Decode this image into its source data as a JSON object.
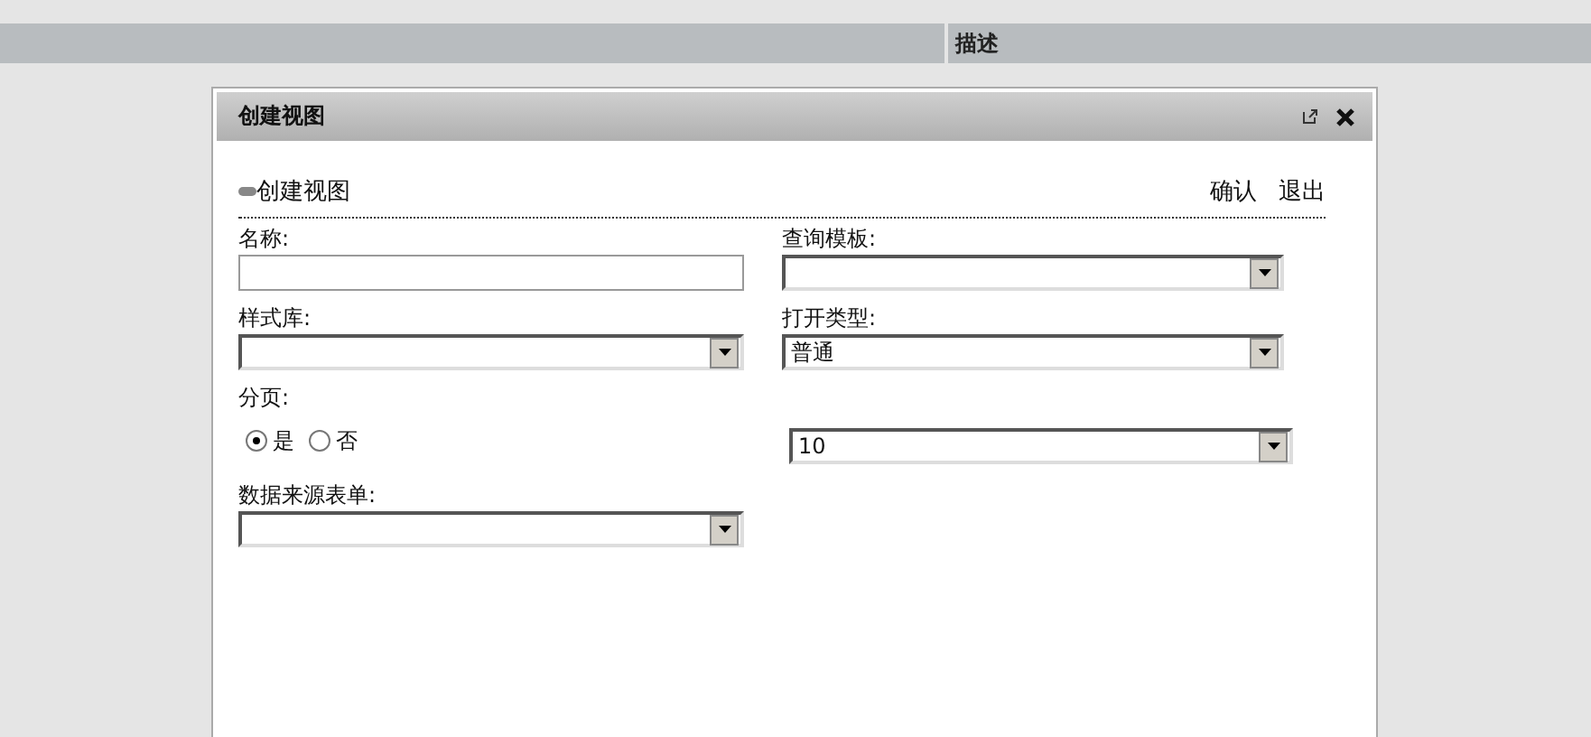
{
  "header_column": "描述",
  "dialog": {
    "title": "创建视图",
    "section_title": "创建视图",
    "actions": [
      "确认",
      "退出"
    ],
    "fields": [
      {
        "kind": "text",
        "label": "名称:"
      },
      {
        "kind": "select",
        "label": "查询模板:"
      },
      {
        "kind": "select",
        "label": "样式库:"
      },
      {
        "kind": "select",
        "label": "打开类型:",
        "value": "普通"
      },
      {
        "kind": "radio",
        "label": "分页:",
        "options": [
          {
            "label": "是",
            "selected": true
          },
          {
            "label": "否",
            "selected": false
          }
        ]
      },
      {
        "kind": "select",
        "value": "10"
      },
      {
        "kind": "select",
        "label": "数据来源表单:"
      }
    ]
  }
}
